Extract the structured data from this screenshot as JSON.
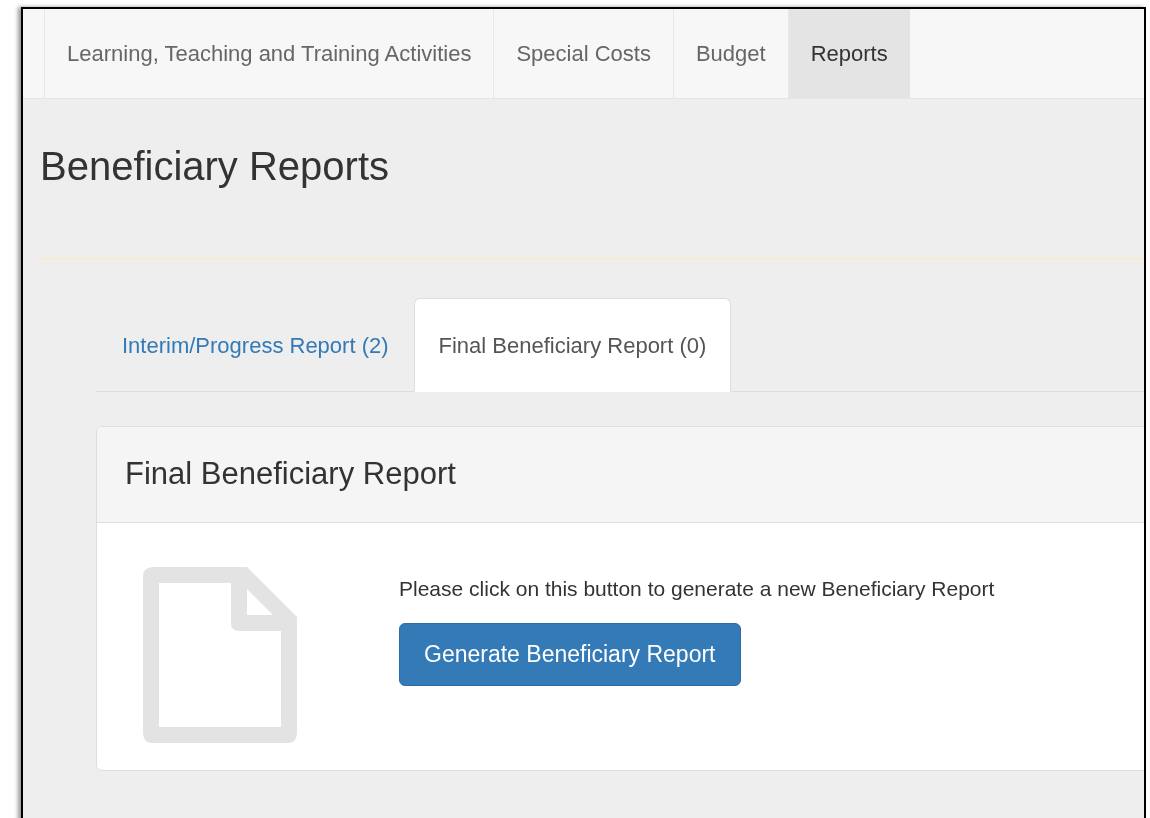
{
  "nav": [
    {
      "label": "Learning, Teaching and Training Activities",
      "selected": false
    },
    {
      "label": "Special Costs",
      "selected": false
    },
    {
      "label": "Budget",
      "selected": false
    },
    {
      "label": "Reports",
      "selected": true
    }
  ],
  "title": "Beneficiary Reports",
  "tabs": [
    {
      "label": "Interim/Progress Report (2)",
      "selected": false
    },
    {
      "label": "Final Beneficiary Report (0)",
      "selected": true
    }
  ],
  "panel": {
    "title": "Final Beneficiary Report",
    "message": "Please click on this button to generate a new Beneficiary Report",
    "button": "Generate Beneficiary Report"
  }
}
